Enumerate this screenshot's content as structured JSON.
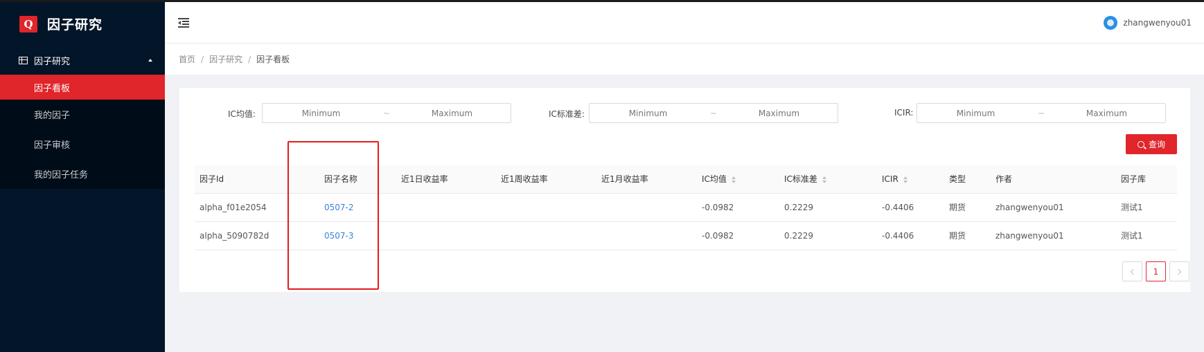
{
  "app": {
    "logo_letter": "Q",
    "title": "因子研究"
  },
  "sidebar": {
    "group_label": "因子研究",
    "items": [
      {
        "label": "因子看板",
        "active": true
      },
      {
        "label": "我的因子"
      },
      {
        "label": "因子审核"
      },
      {
        "label": "我的因子任务"
      }
    ]
  },
  "header": {
    "username": "zhangwenyou01"
  },
  "breadcrumb": {
    "home": "首页",
    "section": "因子研究",
    "current": "因子看板",
    "separator": "/"
  },
  "filters": {
    "ic_mean": {
      "label": "IC均值:",
      "min_placeholder": "Minimum",
      "max_placeholder": "Maximum"
    },
    "ic_std": {
      "label": "IC标准差:",
      "min_placeholder": "Minimum",
      "max_placeholder": "Maximum"
    },
    "icir": {
      "label": "ICIR:",
      "min_placeholder": "Minimum",
      "max_placeholder": "Maximum"
    },
    "range_separator": "~",
    "query_label": "查询"
  },
  "table": {
    "columns": [
      "因子Id",
      "因子名称",
      "近1日收益率",
      "近1周收益率",
      "近1月收益率",
      "IC均值",
      "IC标准差",
      "ICIR",
      "类型",
      "作者",
      "因子库"
    ],
    "rows": [
      [
        "alpha_f01e2054",
        "0507-2",
        "",
        "",
        "",
        "-0.0982",
        "0.2229",
        "-0.4406",
        "期货",
        "zhangwenyou01",
        "测试1"
      ],
      [
        "alpha_5090782d",
        "0507-3",
        "",
        "",
        "",
        "-0.0982",
        "0.2229",
        "-0.4406",
        "期货",
        "zhangwenyou01",
        "测试1"
      ]
    ]
  },
  "pagination": {
    "current_page": "1"
  },
  "colors": {
    "accent": "#e0252b",
    "sidebar_bg": "#031528",
    "link": "#3b82d6",
    "highlight": "#e21b1b"
  }
}
